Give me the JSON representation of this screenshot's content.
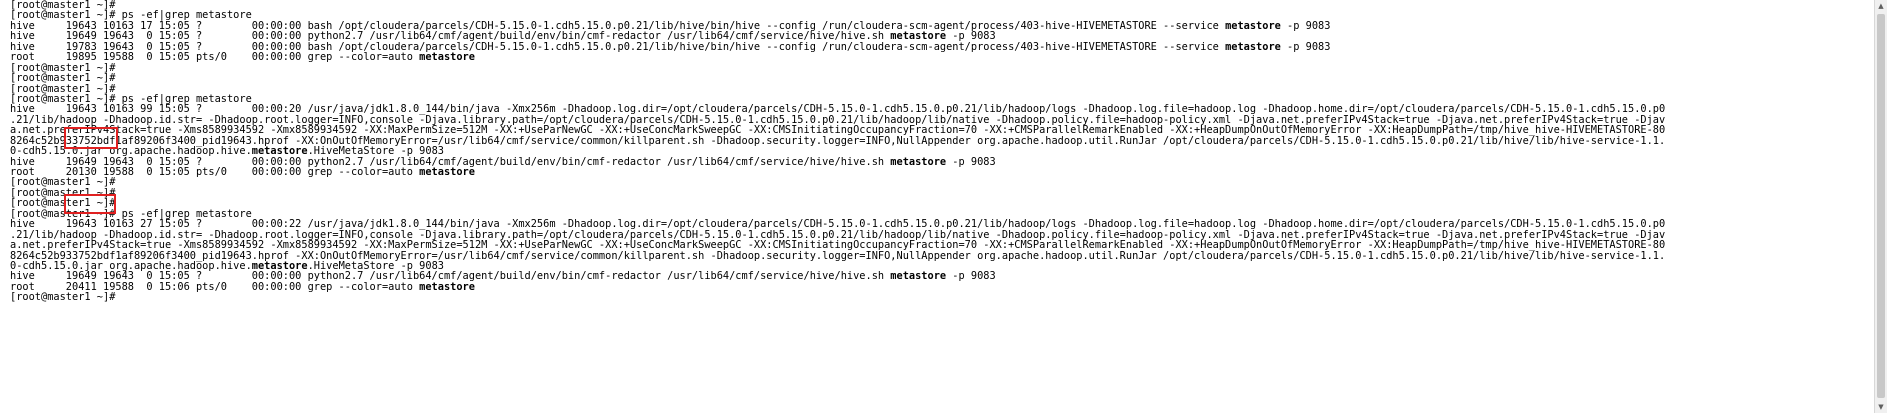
{
  "terminal": {
    "lines": [
      [
        {
          "t": "[root@master1 ~]#"
        }
      ],
      [
        {
          "t": "[root@master1 ~]# ps -ef|grep metastore"
        }
      ],
      [
        {
          "t": "hive     19643 10163 17 15:05 ?        00:00:00 bash /opt/cloudera/parcels/CDH-5.15.0-1.cdh5.15.0.p0.21/lib/hive/bin/hive --config /run/cloudera-scm-agent/process/403-hive-HIVEMETASTORE --service "
        },
        {
          "t": "metastore",
          "b": true
        },
        {
          "t": " -p 9083"
        }
      ],
      [
        {
          "t": "hive     19649 19643  0 15:05 ?        00:00:00 python2.7 /usr/lib64/cmf/agent/build/env/bin/cmf-redactor /usr/lib64/cmf/service/hive/hive.sh "
        },
        {
          "t": "metastore",
          "b": true
        },
        {
          "t": " -p 9083"
        }
      ],
      [
        {
          "t": "hive     19783 19643  0 15:05 ?        00:00:00 bash /opt/cloudera/parcels/CDH-5.15.0-1.cdh5.15.0.p0.21/lib/hive/bin/hive --config /run/cloudera-scm-agent/process/403-hive-HIVEMETASTORE --service "
        },
        {
          "t": "metastore",
          "b": true
        },
        {
          "t": " -p 9083"
        }
      ],
      [
        {
          "t": "root     19895 19588  0 15:05 pts/0    00:00:00 grep --color=auto "
        },
        {
          "t": "metastore",
          "b": true
        }
      ],
      [
        {
          "t": "[root@master1 ~]#"
        }
      ],
      [
        {
          "t": "[root@master1 ~]#"
        }
      ],
      [
        {
          "t": "[root@master1 ~]#"
        }
      ],
      [
        {
          "t": "[root@master1 ~]# ps -ef|grep metastore"
        }
      ],
      [
        {
          "t": "hive     19643 10163 99 15:05 ?        00:00:20 /usr/java/jdk1.8.0_144/bin/java -Xmx256m -Dhadoop.log.dir=/opt/cloudera/parcels/CDH-5.15.0-1.cdh5.15.0.p0.21/lib/hadoop/logs -Dhadoop.log.file=hadoop.log -Dhadoop.home.dir=/opt/cloudera/parcels/CDH-5.15.0-1.cdh5.15.0.p0"
        }
      ],
      [
        {
          "t": ".21/lib/hadoop -Dhadoop.id.str= -Dhadoop.root.logger=INFO,console -Djava.library.path=/opt/cloudera/parcels/CDH-5.15.0-1.cdh5.15.0.p0.21/lib/hadoop/lib/native -Dhadoop.policy.file=hadoop-policy.xml -Djava.net.preferIPv4Stack=true -Djava.net.preferIPv4Stack=true -Djav"
        }
      ],
      [
        {
          "t": "a.net.preferIPv4Stack=true -Xms8589934592 -Xmx8589934592 -XX:MaxPermSize=512M -XX:+UseParNewGC -XX:+UseConcMarkSweepGC -XX:CMSInitiatingOccupancyFraction=70 -XX:+CMSParallelRemarkEnabled -XX:+HeapDumpOnOutOfMemoryError -XX:HeapDumpPath=/tmp/hive_hive-HIVEMETASTORE-80"
        }
      ],
      [
        {
          "t": "8264c52b933752bdf1af89206f3400_pid19643.hprof -XX:OnOutOfMemoryError=/usr/lib64/cmf/service/common/killparent.sh -Dhadoop.security.logger=INFO,NullAppender org.apache.hadoop.util.RunJar /opt/cloudera/parcels/CDH-5.15.0-1.cdh5.15.0.p0.21/lib/hive/lib/hive-service-1.1."
        }
      ],
      [
        {
          "t": "0-cdh5.15.0.jar org.apache.hadoop.hive."
        },
        {
          "t": "metastore",
          "b": true
        },
        {
          "t": ".HiveMetaStore -p 9083"
        }
      ],
      [
        {
          "t": "hive     19649 19643  0 15:05 ?        00:00:00 python2.7 /usr/lib64/cmf/agent/build/env/bin/cmf-redactor /usr/lib64/cmf/service/hive/hive.sh "
        },
        {
          "t": "metastore",
          "b": true
        },
        {
          "t": " -p 9083"
        }
      ],
      [
        {
          "t": "root     20130 19588  0 15:05 pts/0    00:00:00 grep --color=auto "
        },
        {
          "t": "metastore",
          "b": true
        }
      ],
      [
        {
          "t": "[root@master1 ~]#"
        }
      ],
      [
        {
          "t": "[root@master1 ~]#"
        }
      ],
      [
        {
          "t": "[root@master1 ~]#"
        }
      ],
      [
        {
          "t": "[root@master1 ~]# ps -ef|grep metastore"
        }
      ],
      [
        {
          "t": "hive     19643 10163 27 15:05 ?        00:00:22 /usr/java/jdk1.8.0_144/bin/java -Xmx256m -Dhadoop.log.dir=/opt/cloudera/parcels/CDH-5.15.0-1.cdh5.15.0.p0.21/lib/hadoop/logs -Dhadoop.log.file=hadoop.log -Dhadoop.home.dir=/opt/cloudera/parcels/CDH-5.15.0-1.cdh5.15.0.p0"
        }
      ],
      [
        {
          "t": ".21/lib/hadoop -Dhadoop.id.str= -Dhadoop.root.logger=INFO,console -Djava.library.path=/opt/cloudera/parcels/CDH-5.15.0-1.cdh5.15.0.p0.21/lib/hadoop/lib/native -Dhadoop.policy.file=hadoop-policy.xml -Djava.net.preferIPv4Stack=true -Djava.net.preferIPv4Stack=true -Djav"
        }
      ],
      [
        {
          "t": "a.net.preferIPv4Stack=true -Xms8589934592 -Xmx8589934592 -XX:MaxPermSize=512M -XX:+UseParNewGC -XX:+UseConcMarkSweepGC -XX:CMSInitiatingOccupancyFraction=70 -XX:+CMSParallelRemarkEnabled -XX:+HeapDumpOnOutOfMemoryError -XX:HeapDumpPath=/tmp/hive_hive-HIVEMETASTORE-80"
        }
      ],
      [
        {
          "t": "8264c52b933752bdf1af89206f3400_pid19643.hprof -XX:OnOutOfMemoryError=/usr/lib64/cmf/service/common/killparent.sh -Dhadoop.security.logger=INFO,NullAppender org.apache.hadoop.util.RunJar /opt/cloudera/parcels/CDH-5.15.0-1.cdh5.15.0.p0.21/lib/hive/lib/hive-service-1.1."
        }
      ],
      [
        {
          "t": "0-cdh5.15.0.jar org.apache.hadoop.hive."
        },
        {
          "t": "metastore",
          "b": true
        },
        {
          "t": ".HiveMetaStore -p 9083"
        }
      ],
      [
        {
          "t": "hive     19649 19643  0 15:05 ?        00:00:00 python2.7 /usr/lib64/cmf/agent/build/env/bin/cmf-redactor /usr/lib64/cmf/service/hive/hive.sh "
        },
        {
          "t": "metastore",
          "b": true
        },
        {
          "t": " -p 9083"
        }
      ],
      [
        {
          "t": "root     20411 19588  0 15:06 pts/0    00:00:00 grep --color=auto "
        },
        {
          "t": "metastore",
          "b": true
        }
      ],
      [
        {
          "t": "[root@master1 ~]#"
        }
      ]
    ]
  },
  "colors": {
    "background": "#ffffff",
    "text": "#000000",
    "highlight_box": "#e02020"
  },
  "icons": {
    "scroll_up": "scroll-up-arrow-icon",
    "scroll_down": "scroll-down-arrow-icon"
  }
}
